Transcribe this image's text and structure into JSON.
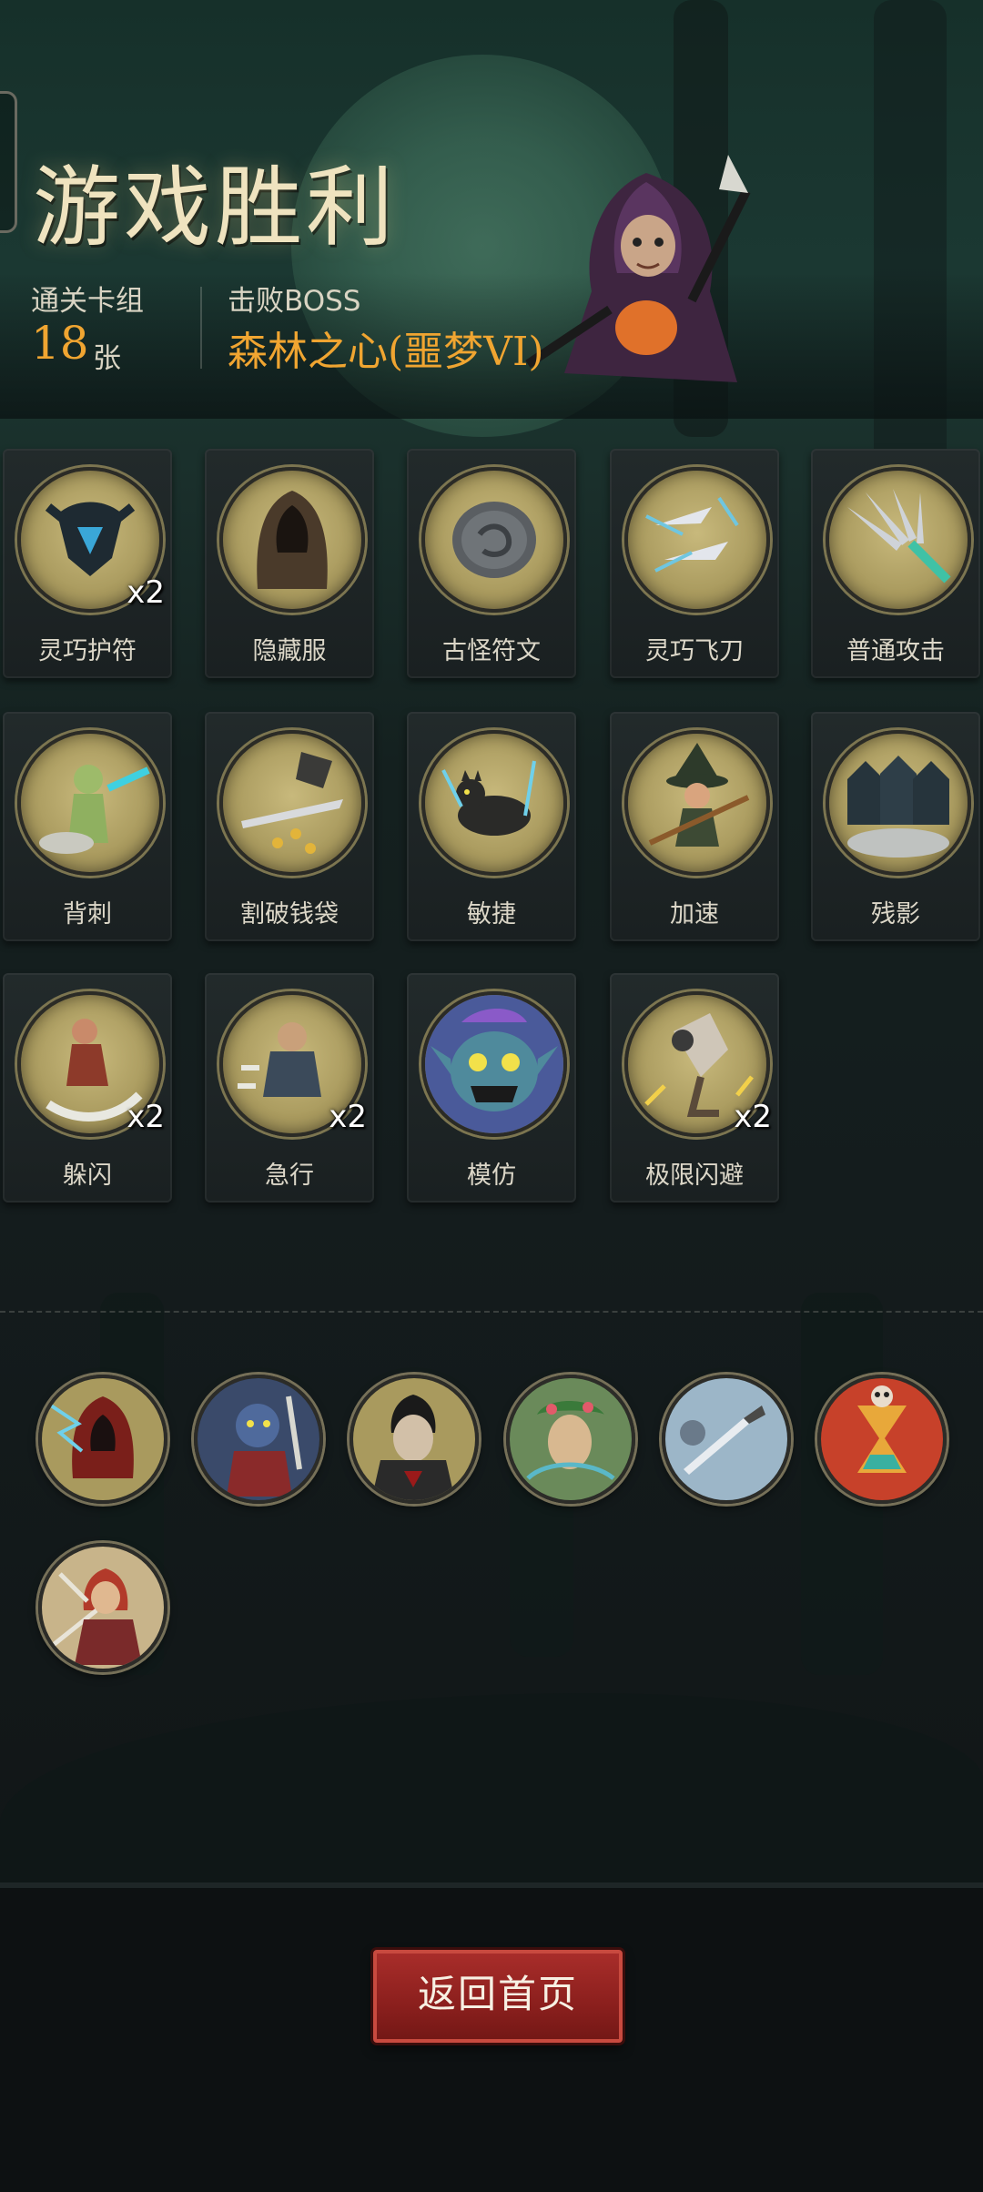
{
  "colors": {
    "accent_gold": "#f0a531",
    "title": "#efe3bf",
    "button_red": "#8b1f1d",
    "card_art_bg": "#b1a366"
  },
  "header": {
    "title": "游戏胜利",
    "deck_label": "通关卡组",
    "deck_count": "18",
    "deck_unit": "张",
    "boss_label": "击败BOSS",
    "boss_name": "森林之心(噩梦VI)"
  },
  "cards": [
    {
      "name": "灵巧护符",
      "count": "x2",
      "icon": "amulet-icon"
    },
    {
      "name": "隐藏服",
      "count": "",
      "icon": "hooded-cloak-icon"
    },
    {
      "name": "古怪符文",
      "count": "",
      "icon": "rune-stone-icon"
    },
    {
      "name": "灵巧飞刀",
      "count": "",
      "icon": "flying-knives-icon"
    },
    {
      "name": "普通攻击",
      "count": "",
      "icon": "daggers-icon"
    },
    {
      "name": "背刺",
      "count": "",
      "icon": "backstab-icon"
    },
    {
      "name": "割破钱袋",
      "count": "",
      "icon": "cut-purse-icon"
    },
    {
      "name": "敏捷",
      "count": "",
      "icon": "black-cat-icon"
    },
    {
      "name": "加速",
      "count": "",
      "icon": "witch-icon"
    },
    {
      "name": "残影",
      "count": "",
      "icon": "afterimage-icon"
    },
    {
      "name": "躲闪",
      "count": "x2",
      "icon": "dodge-icon"
    },
    {
      "name": "急行",
      "count": "x2",
      "icon": "dash-icon"
    },
    {
      "name": "模仿",
      "count": "",
      "icon": "goblin-face-icon"
    },
    {
      "name": "极限闪避",
      "count": "x2",
      "icon": "extreme-dodge-icon"
    }
  ],
  "relics": [
    {
      "icon": "lightning-hood-icon"
    },
    {
      "icon": "goblin-warrior-icon"
    },
    {
      "icon": "vampire-icon"
    },
    {
      "icon": "dryad-icon"
    },
    {
      "icon": "dagger-relic-icon"
    },
    {
      "icon": "hourglass-icon"
    },
    {
      "icon": "red-hood-icon"
    }
  ],
  "button": {
    "return_home": "返回首页"
  }
}
